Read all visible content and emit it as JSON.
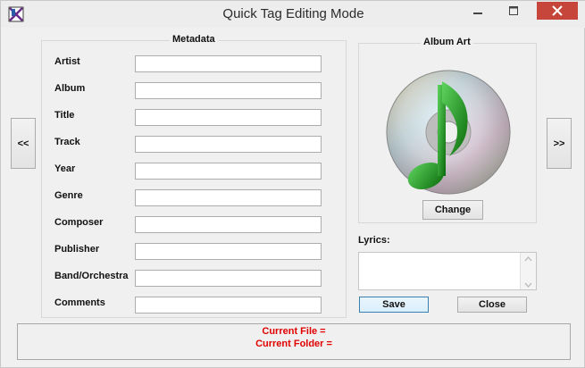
{
  "window": {
    "title": "Quick Tag Editing Mode",
    "minimize_label": "—",
    "maximize_label": "☐",
    "close_label": "✕"
  },
  "metadata": {
    "group_title": "Metadata",
    "fields": [
      {
        "label": "Artist",
        "value": ""
      },
      {
        "label": "Album",
        "value": ""
      },
      {
        "label": "Title",
        "value": ""
      },
      {
        "label": "Track",
        "value": ""
      },
      {
        "label": "Year",
        "value": ""
      },
      {
        "label": "Genre",
        "value": ""
      },
      {
        "label": "Composer",
        "value": ""
      },
      {
        "label": "Publisher",
        "value": ""
      },
      {
        "label": "Band/Orchestra",
        "value": ""
      },
      {
        "label": "Comments",
        "value": ""
      }
    ]
  },
  "navigation": {
    "prev_label": "<<",
    "next_label": ">>"
  },
  "album_art": {
    "group_title": "Album Art",
    "image_icon": "cd-music-note-icon",
    "change_label": "Change"
  },
  "lyrics": {
    "label": "Lyrics:",
    "value": ""
  },
  "actions": {
    "save_label": "Save",
    "close_label": "Close"
  },
  "status": {
    "current_file": "Current File =",
    "current_folder": "Current Folder ="
  },
  "colors": {
    "status_text": "#e00000",
    "close_button": "#c7463b",
    "note_green": "#1f9a1f"
  }
}
